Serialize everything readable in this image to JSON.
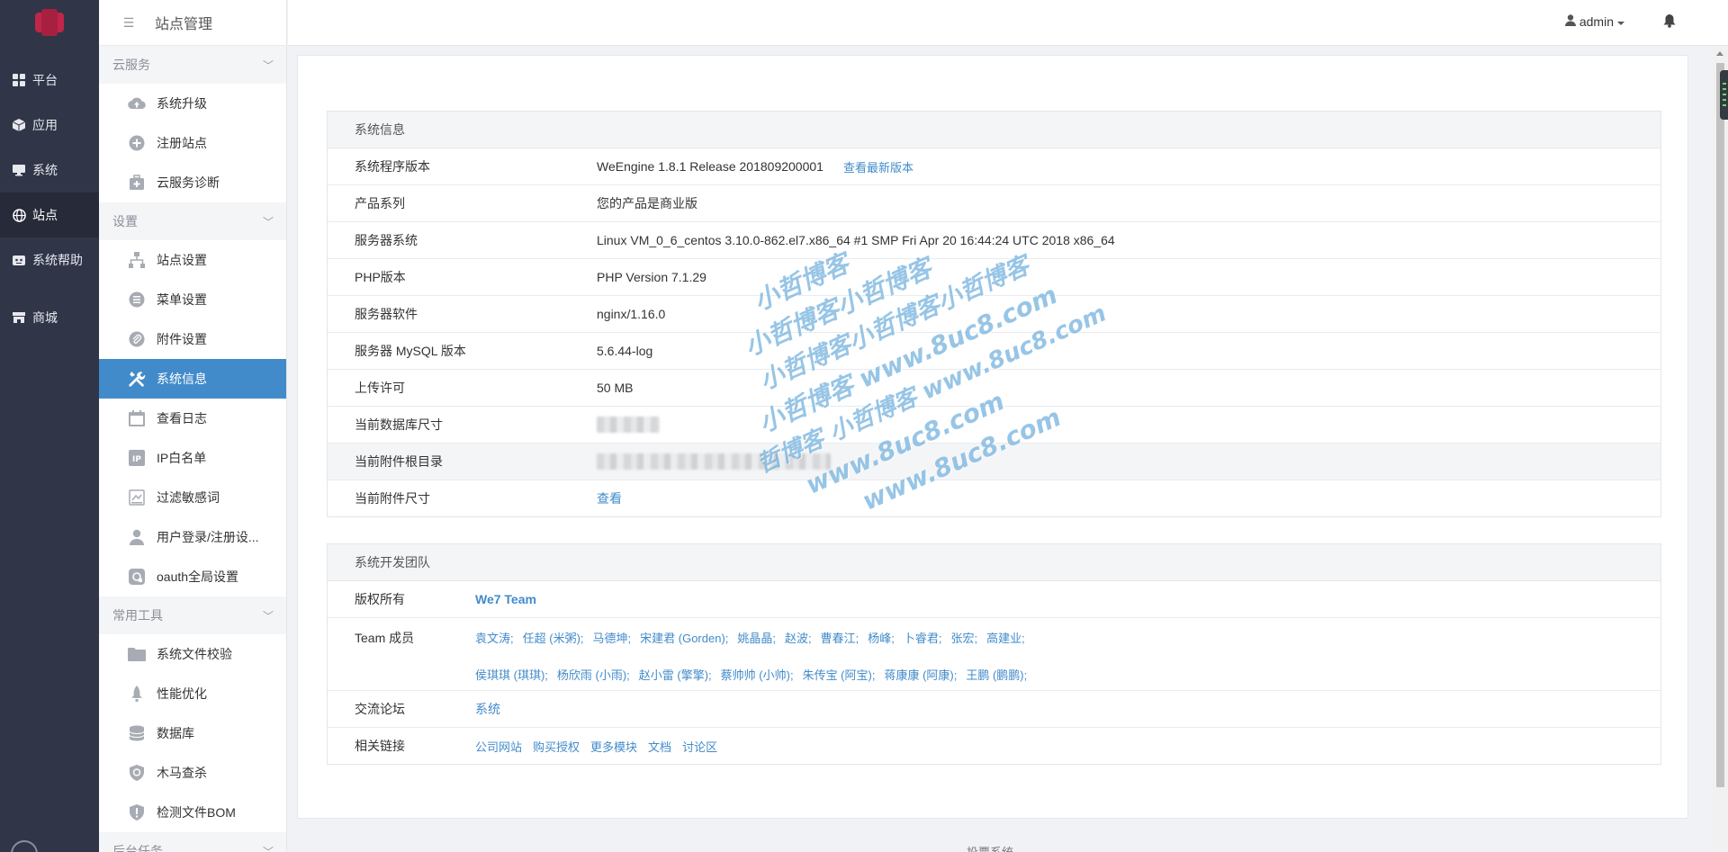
{
  "rail": {
    "items": [
      {
        "label": "平台",
        "icon": "grid-icon"
      },
      {
        "label": "应用",
        "icon": "cube-icon"
      },
      {
        "label": "系统",
        "icon": "monitor-icon"
      },
      {
        "label": "站点",
        "icon": "globe-icon"
      },
      {
        "label": "系统帮助",
        "icon": "robot-icon"
      },
      {
        "label": "商城",
        "icon": "store-icon"
      }
    ],
    "active": "站点"
  },
  "sidebar": {
    "title": "站点管理",
    "groups": [
      {
        "label": "云服务",
        "items": [
          {
            "label": "系统升级",
            "icon": "cloud-upload-icon"
          },
          {
            "label": "注册站点",
            "icon": "plus-circle-icon"
          },
          {
            "label": "云服务诊断",
            "icon": "medkit-icon"
          }
        ]
      },
      {
        "label": "设置",
        "items": [
          {
            "label": "站点设置",
            "icon": "sitemap-icon"
          },
          {
            "label": "菜单设置",
            "icon": "list-icon"
          },
          {
            "label": "附件设置",
            "icon": "paperclip-icon"
          },
          {
            "label": "系统信息",
            "icon": "wrench-icon"
          },
          {
            "label": "查看日志",
            "icon": "calendar-icon"
          },
          {
            "label": "IP白名单",
            "icon": "ip-icon"
          },
          {
            "label": "过滤敏感词",
            "icon": "filter-icon"
          },
          {
            "label": "用户登录/注册设...",
            "icon": "user-icon"
          },
          {
            "label": "oauth全局设置",
            "icon": "oauth-icon"
          }
        ]
      },
      {
        "label": "常用工具",
        "items": [
          {
            "label": "系统文件校验",
            "icon": "folder-icon"
          },
          {
            "label": "性能优化",
            "icon": "rocket-icon"
          },
          {
            "label": "数据库",
            "icon": "database-icon"
          },
          {
            "label": "木马查杀",
            "icon": "shield-icon"
          },
          {
            "label": "检测文件BOM",
            "icon": "shield-check-icon"
          }
        ]
      },
      {
        "label": "后台任务"
      }
    ],
    "active": "系统信息"
  },
  "header": {
    "user": "admin",
    "icons": [
      "user-icon",
      "caret-down-icon",
      "bell-icon"
    ]
  },
  "sysinfo": {
    "title": "系统信息",
    "rows": [
      {
        "key": "系统程序版本",
        "value": "WeEngine 1.8.1 Release 201809200001",
        "link": "查看最新版本"
      },
      {
        "key": "产品系列",
        "value": "您的产品是商业版"
      },
      {
        "key": "服务器系统",
        "value": "Linux VM_0_6_centos 3.10.0-862.el7.x86_64 #1 SMP Fri Apr 20 16:44:24 UTC 2018 x86_64"
      },
      {
        "key": "PHP版本",
        "value": "PHP Version 7.1.29"
      },
      {
        "key": "服务器软件",
        "value": "nginx/1.16.0"
      },
      {
        "key": "服务器 MySQL 版本",
        "value": "5.6.44-log"
      },
      {
        "key": "上传许可",
        "value": "50 MB"
      },
      {
        "key": "当前数据库尺寸",
        "value": ""
      },
      {
        "key": "当前附件根目录",
        "value": ""
      },
      {
        "key": "当前附件尺寸",
        "link": "查看"
      }
    ]
  },
  "team": {
    "title": "系统开发团队",
    "copyright_label": "版权所有",
    "copyright_value": "We7 Team",
    "members_label": "Team 成员",
    "members_line1": [
      "袁文涛;",
      "任超 (米粥);",
      "马德坤;",
      "宋建君 (Gorden);",
      "姚晶晶;",
      "赵波;",
      "曹春江;",
      "杨峰;",
      "卜睿君;",
      "张宏;",
      "高建业;"
    ],
    "members_line2": [
      "侯琪琪 (琪琪);",
      "杨欣雨 (小雨);",
      "赵小雷 (擎擎);",
      "蔡帅帅 (小帅);",
      "朱传宝 (阿宝);",
      "蒋康康 (阿康);",
      "王鹏 (鹏鹏);"
    ],
    "forum_label": "交流论坛",
    "forum_value": "系统",
    "links_label": "相关链接",
    "links": [
      "公司网站",
      "购买授权",
      "更多模块",
      "文档",
      "讨论区"
    ]
  },
  "footer": {
    "text": "投票系统"
  },
  "watermark": {
    "lines": [
      "小哲博客",
      "小哲博客小哲博客",
      "小哲博客小哲博客小哲博客",
      "小哲博客 www.8uc8.com",
      "哲博客 小哲博客 www.8uc8.com",
      "www.8uc8.com",
      "www.8uc8.com"
    ]
  },
  "colors": {
    "accent": "#428bca",
    "rail_bg": "#303547",
    "active_bg": "#428bca"
  }
}
